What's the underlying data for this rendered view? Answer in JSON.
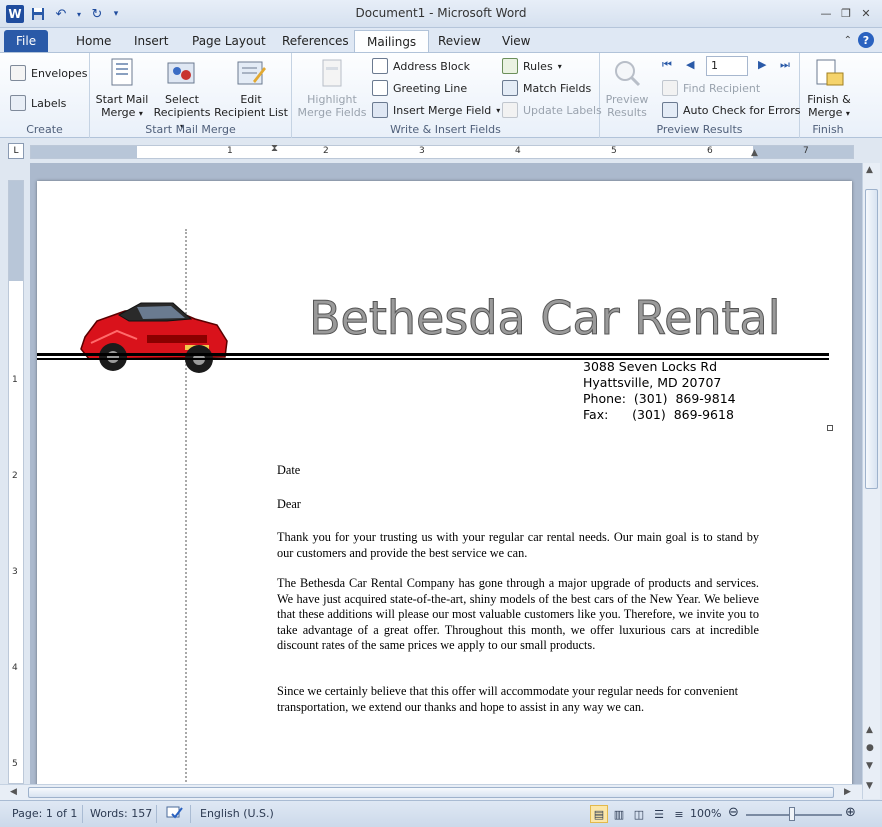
{
  "window": {
    "title": "Document1  -  Microsoft Word",
    "app_logo": "W"
  },
  "tabs": [
    {
      "label": "File"
    },
    {
      "label": "Home"
    },
    {
      "label": "Insert"
    },
    {
      "label": "Page Layout"
    },
    {
      "label": "References"
    },
    {
      "label": "Mailings"
    },
    {
      "label": "Review"
    },
    {
      "label": "View"
    }
  ],
  "ribbon": {
    "create": {
      "label": "Create",
      "envelopes": "Envelopes",
      "labels": "Labels"
    },
    "start_mail_merge": {
      "label": "Start Mail Merge",
      "start_mail_merge_line1": "Start Mail",
      "start_mail_merge_line2": "Merge",
      "select_recipients_line1": "Select",
      "select_recipients_line2": "Recipients",
      "edit_recipient_list_line1": "Edit",
      "edit_recipient_list_line2": "Recipient List"
    },
    "write_insert": {
      "label": "Write & Insert Fields",
      "highlight_line1": "Highlight",
      "highlight_line2": "Merge Fields",
      "address_block": "Address Block",
      "greeting_line": "Greeting Line",
      "insert_merge_field": "Insert Merge Field",
      "rules": "Rules",
      "match_fields": "Match Fields",
      "update_labels": "Update Labels"
    },
    "preview": {
      "label": "Preview Results",
      "preview_line1": "Preview",
      "preview_line2": "Results",
      "record_number": "1",
      "find_recipient": "Find Recipient",
      "auto_check": "Auto Check for Errors"
    },
    "finish": {
      "label": "Finish",
      "finish_line1": "Finish &",
      "finish_line2": "Merge"
    }
  },
  "ruler": {
    "corner": "L",
    "labels": [
      "1",
      "1",
      "2",
      "3",
      "4",
      "5",
      "6",
      "7"
    ],
    "vlabels": [
      "1",
      "1",
      "2",
      "3",
      "4",
      "5"
    ]
  },
  "document": {
    "company_name": "Bethesda Car Rental",
    "address_lines": [
      "3088 Seven Locks Rd",
      "Hyattsville, MD 20707",
      "Phone:  (301)  869-9814",
      "Fax:      (301)  869-9618"
    ],
    "date": "Date",
    "dear": "Dear",
    "paragraph1": "Thank you for your trusting us with your regular car rental needs. Our main goal is to stand by our customers and provide the best service we can.",
    "paragraph2": "The Bethesda Car Rental Company has gone through a major upgrade of products and services. We have just acquired state-of-the-art, shiny models of the best cars of the New Year. We believe that these additions will please our most valuable customers like you. Therefore, we invite you to take advantage of a great offer. Throughout this month, we offer luxurious cars at incredible discount rates of the same prices we apply to our small products.",
    "paragraph3": "Since we certainly believe that this offer will  accommodate your regular needs for convenient transportation, we extend our thanks and hope to assist in any way we can."
  },
  "status": {
    "page": "Page: 1 of 1",
    "words": "Words: 157",
    "language": "English (U.S.)",
    "zoom": "100%",
    "zoom_level": 100
  },
  "colors": {
    "file_tab": "#2a5aa8",
    "car": "#d9121b"
  }
}
